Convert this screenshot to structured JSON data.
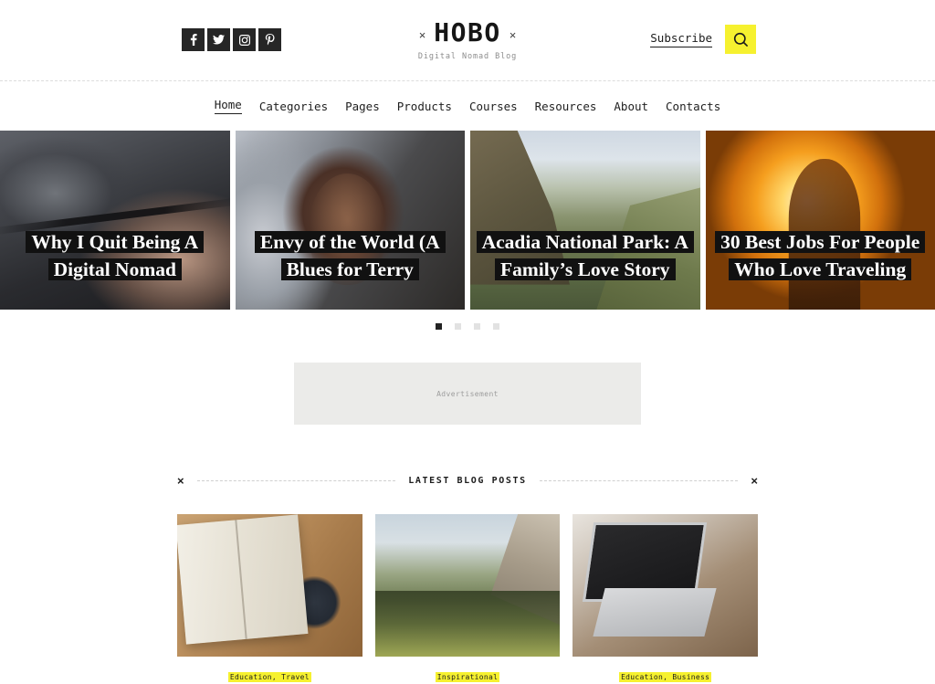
{
  "header": {
    "logo_text": "HOBO",
    "logo_mark_left": "×",
    "logo_mark_right": "×",
    "tagline": "Digital Nomad Blog",
    "subscribe_label": "Subscribe",
    "search_icon": "search-icon",
    "social": [
      {
        "name": "facebook",
        "glyph": "f"
      },
      {
        "name": "twitter",
        "glyph": "t"
      },
      {
        "name": "instagram",
        "glyph": "i"
      },
      {
        "name": "pinterest",
        "glyph": "p"
      }
    ]
  },
  "nav": {
    "items": [
      {
        "label": "Home",
        "active": true
      },
      {
        "label": "Categories",
        "active": false
      },
      {
        "label": "Pages",
        "active": false
      },
      {
        "label": "Products",
        "active": false
      },
      {
        "label": "Courses",
        "active": false
      },
      {
        "label": "Resources",
        "active": false
      },
      {
        "label": "About",
        "active": false
      },
      {
        "label": "Contacts",
        "active": false
      }
    ]
  },
  "slider": {
    "slides": [
      {
        "title": "Why I Quit Being A Digital Nomad",
        "image": "hands-typing-on-laptop-dark"
      },
      {
        "title": "Envy of the World (A Blues for Terry",
        "image": "smiling-woman-portrait"
      },
      {
        "title": "Acadia National Park: A Family’s Love Story",
        "image": "hiker-on-rock-overlooking-valley"
      },
      {
        "title": "30 Best  Jobs For People Who Love Traveling",
        "image": "person-silhouette-at-sunset"
      }
    ],
    "dots": [
      {
        "active": true
      },
      {
        "active": false
      },
      {
        "active": false
      },
      {
        "active": false
      }
    ]
  },
  "advertisement": {
    "label": "Advertisement"
  },
  "latest_posts": {
    "section_title": "LATEST BLOG POSTS",
    "marker_left": "×",
    "marker_right": "×",
    "posts": [
      {
        "categories": "Education, Travel",
        "image": "open-book-and-coffee-mug-on-wooden-desk"
      },
      {
        "categories": "Inspirational",
        "image": "pine-forest-valley-with-cliff"
      },
      {
        "categories": "Education, Business",
        "image": "person-typing-on-laptop"
      }
    ]
  },
  "colors": {
    "accent_yellow": "#f6f12f",
    "ink": "#1c1c1c",
    "social_bg": "#262626",
    "ad_bg": "#ebebe9"
  }
}
